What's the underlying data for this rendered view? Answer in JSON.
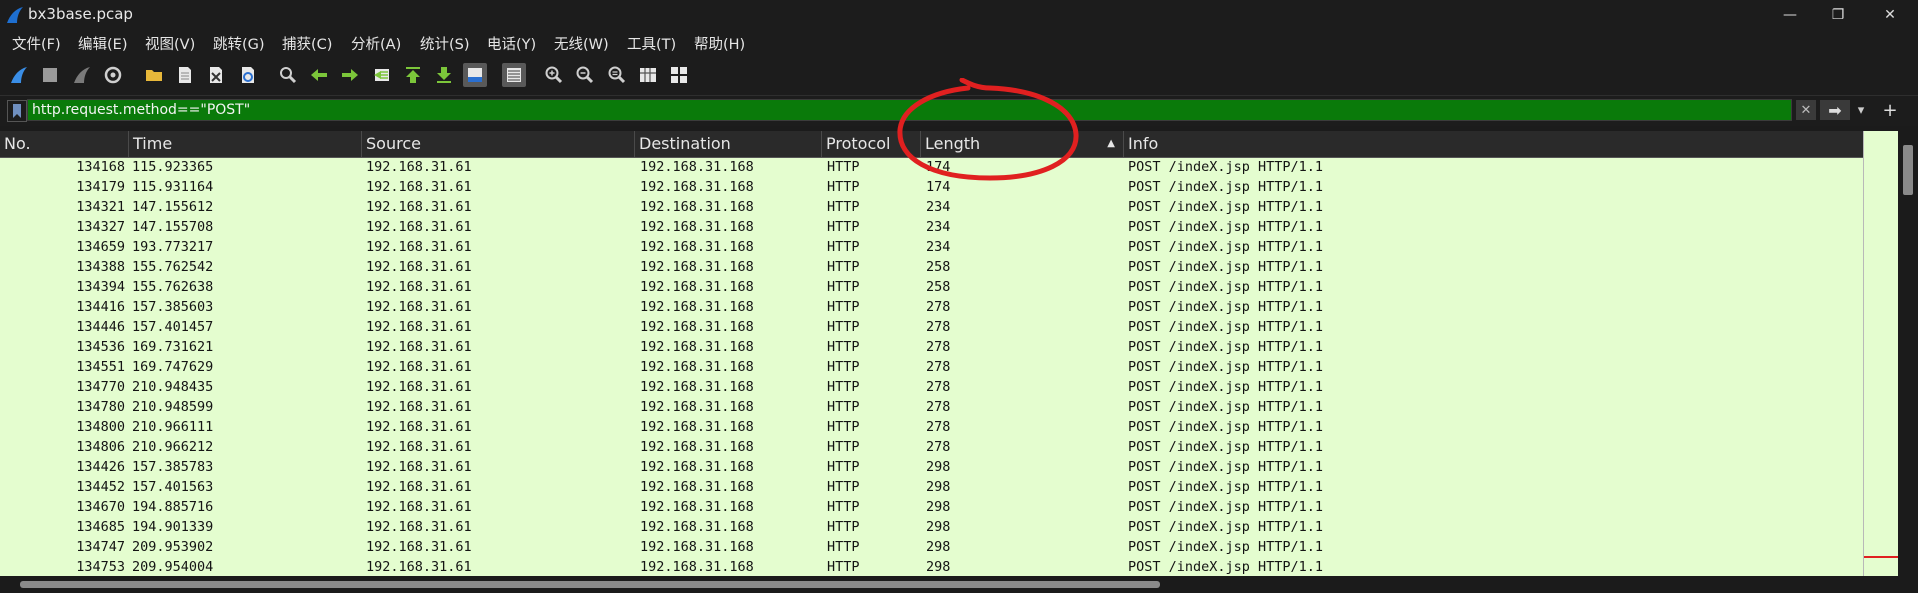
{
  "window": {
    "title": "bx3base.pcap",
    "minimize": "—",
    "restore": "❐",
    "close": "✕"
  },
  "menu": [
    "文件(F)",
    "编辑(E)",
    "视图(V)",
    "跳转(G)",
    "捕获(C)",
    "分析(A)",
    "统计(S)",
    "电话(Y)",
    "无线(W)",
    "工具(T)",
    "帮助(H)"
  ],
  "toolbar_icons": [
    "start-capture-icon",
    "stop-capture-icon",
    "restart-capture-icon",
    "capture-options-icon",
    "open-file-icon",
    "save-file-icon",
    "close-file-icon",
    "reload-file-icon",
    "find-packet-icon",
    "go-back-icon",
    "go-forward-icon",
    "go-to-packet-icon",
    "go-first-icon",
    "go-last-icon",
    "auto-scroll-icon",
    "colorize-icon",
    "zoom-in-icon",
    "zoom-out-icon",
    "normal-size-icon",
    "resize-columns-icon",
    "expand-subtrees-icon"
  ],
  "filter": {
    "value": "http.request.method==\"POST\"",
    "clear": "✕",
    "apply": "➡",
    "dropdown": "▾",
    "add": "+"
  },
  "columns": {
    "no": "No.",
    "time": "Time",
    "source": "Source",
    "destination": "Destination",
    "protocol": "Protocol",
    "length": "Length",
    "sort_indicator": "▲",
    "info": "Info"
  },
  "packets": [
    {
      "no": "134168",
      "time": "115.923365",
      "src": "192.168.31.61",
      "dst": "192.168.31.168",
      "proto": "HTTP",
      "len": "174",
      "info": "POST /indeX.jsp HTTP/1.1"
    },
    {
      "no": "134179",
      "time": "115.931164",
      "src": "192.168.31.61",
      "dst": "192.168.31.168",
      "proto": "HTTP",
      "len": "174",
      "info": "POST /indeX.jsp HTTP/1.1"
    },
    {
      "no": "134321",
      "time": "147.155612",
      "src": "192.168.31.61",
      "dst": "192.168.31.168",
      "proto": "HTTP",
      "len": "234",
      "info": "POST /indeX.jsp HTTP/1.1"
    },
    {
      "no": "134327",
      "time": "147.155708",
      "src": "192.168.31.61",
      "dst": "192.168.31.168",
      "proto": "HTTP",
      "len": "234",
      "info": "POST /indeX.jsp HTTP/1.1"
    },
    {
      "no": "134659",
      "time": "193.773217",
      "src": "192.168.31.61",
      "dst": "192.168.31.168",
      "proto": "HTTP",
      "len": "234",
      "info": "POST /indeX.jsp HTTP/1.1"
    },
    {
      "no": "134388",
      "time": "155.762542",
      "src": "192.168.31.61",
      "dst": "192.168.31.168",
      "proto": "HTTP",
      "len": "258",
      "info": "POST /indeX.jsp HTTP/1.1"
    },
    {
      "no": "134394",
      "time": "155.762638",
      "src": "192.168.31.61",
      "dst": "192.168.31.168",
      "proto": "HTTP",
      "len": "258",
      "info": "POST /indeX.jsp HTTP/1.1"
    },
    {
      "no": "134416",
      "time": "157.385603",
      "src": "192.168.31.61",
      "dst": "192.168.31.168",
      "proto": "HTTP",
      "len": "278",
      "info": "POST /indeX.jsp HTTP/1.1"
    },
    {
      "no": "134446",
      "time": "157.401457",
      "src": "192.168.31.61",
      "dst": "192.168.31.168",
      "proto": "HTTP",
      "len": "278",
      "info": "POST /indeX.jsp HTTP/1.1"
    },
    {
      "no": "134536",
      "time": "169.731621",
      "src": "192.168.31.61",
      "dst": "192.168.31.168",
      "proto": "HTTP",
      "len": "278",
      "info": "POST /indeX.jsp HTTP/1.1"
    },
    {
      "no": "134551",
      "time": "169.747629",
      "src": "192.168.31.61",
      "dst": "192.168.31.168",
      "proto": "HTTP",
      "len": "278",
      "info": "POST /indeX.jsp HTTP/1.1"
    },
    {
      "no": "134770",
      "time": "210.948435",
      "src": "192.168.31.61",
      "dst": "192.168.31.168",
      "proto": "HTTP",
      "len": "278",
      "info": "POST /indeX.jsp HTTP/1.1"
    },
    {
      "no": "134780",
      "time": "210.948599",
      "src": "192.168.31.61",
      "dst": "192.168.31.168",
      "proto": "HTTP",
      "len": "278",
      "info": "POST /indeX.jsp HTTP/1.1"
    },
    {
      "no": "134800",
      "time": "210.966111",
      "src": "192.168.31.61",
      "dst": "192.168.31.168",
      "proto": "HTTP",
      "len": "278",
      "info": "POST /indeX.jsp HTTP/1.1"
    },
    {
      "no": "134806",
      "time": "210.966212",
      "src": "192.168.31.61",
      "dst": "192.168.31.168",
      "proto": "HTTP",
      "len": "278",
      "info": "POST /indeX.jsp HTTP/1.1"
    },
    {
      "no": "134426",
      "time": "157.385783",
      "src": "192.168.31.61",
      "dst": "192.168.31.168",
      "proto": "HTTP",
      "len": "298",
      "info": "POST /indeX.jsp HTTP/1.1"
    },
    {
      "no": "134452",
      "time": "157.401563",
      "src": "192.168.31.61",
      "dst": "192.168.31.168",
      "proto": "HTTP",
      "len": "298",
      "info": "POST /indeX.jsp HTTP/1.1"
    },
    {
      "no": "134670",
      "time": "194.885716",
      "src": "192.168.31.61",
      "dst": "192.168.31.168",
      "proto": "HTTP",
      "len": "298",
      "info": "POST /indeX.jsp HTTP/1.1"
    },
    {
      "no": "134685",
      "time": "194.901339",
      "src": "192.168.31.61",
      "dst": "192.168.31.168",
      "proto": "HTTP",
      "len": "298",
      "info": "POST /indeX.jsp HTTP/1.1"
    },
    {
      "no": "134747",
      "time": "209.953902",
      "src": "192.168.31.61",
      "dst": "192.168.31.168",
      "proto": "HTTP",
      "len": "298",
      "info": "POST /indeX.jsp HTTP/1.1"
    },
    {
      "no": "134753",
      "time": "209.954004",
      "src": "192.168.31.61",
      "dst": "192.168.31.168",
      "proto": "HTTP",
      "len": "298",
      "info": "POST /indeX.jsp HTTP/1.1"
    }
  ],
  "colors": {
    "row_bg": "#e4fdcf",
    "filter_bg": "#0a7a0a",
    "annotation": "#e02020"
  }
}
